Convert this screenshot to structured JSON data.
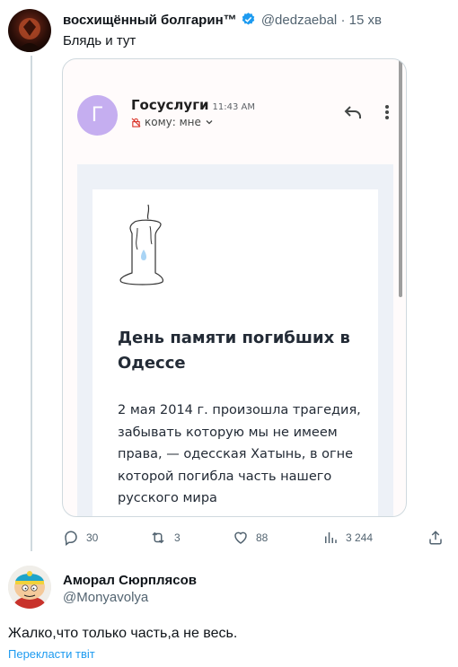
{
  "tweet1": {
    "display_name": "восхищённый болгарин™",
    "handle": "@dedzaebal",
    "separator": "·",
    "time": "15 хв",
    "text": "Блядь и тут",
    "verified_color": "#1d9bf0"
  },
  "email": {
    "avatar_letter": "Г",
    "avatar_color": "#c5aef0",
    "sender": "Госуслуги",
    "time": "11:43 AM",
    "recipient": "кому: мне",
    "heading": "День памяти погибших в Одессе",
    "body": "2 мая 2014 г. произошла трагедия, забывать которую мы не имеем права, — одесская Хатынь, в огне которой погибла часть нашего русского мира"
  },
  "actions": {
    "replies": "30",
    "retweets": "3",
    "likes": "88",
    "views": "3 244"
  },
  "tweet2": {
    "display_name": "Аморал Сюрплясов",
    "handle": "@Monyavolya",
    "text": "Жалко,что только часть,а не весь.",
    "translate_link": "Перекласти твіт"
  }
}
